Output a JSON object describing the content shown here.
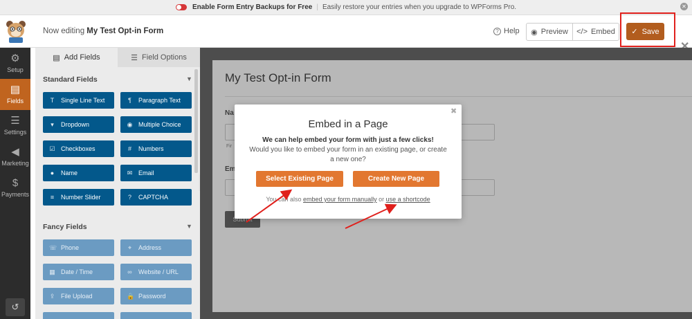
{
  "notice": {
    "title": "Enable Form Entry Backups for Free",
    "text": "Easily restore your entries when you upgrade to WPForms Pro."
  },
  "header": {
    "editing_prefix": "Now editing",
    "form_name": "My Test Opt-in Form",
    "help_label": "Help",
    "preview_label": "Preview",
    "embed_label": "Embed",
    "save_label": "Save"
  },
  "sidebar": {
    "items": [
      {
        "label": "Setup",
        "icon": "gear-icon"
      },
      {
        "label": "Fields",
        "icon": "list-icon"
      },
      {
        "label": "Settings",
        "icon": "sliders-icon"
      },
      {
        "label": "Marketing",
        "icon": "megaphone-icon"
      },
      {
        "label": "Payments",
        "icon": "dollar-icon"
      }
    ]
  },
  "panel": {
    "tabs": [
      {
        "label": "Add Fields"
      },
      {
        "label": "Field Options"
      }
    ],
    "standard_title": "Standard Fields",
    "standard_fields": [
      {
        "label": "Single Line Text",
        "icon": "T"
      },
      {
        "label": "Paragraph Text",
        "icon": "¶"
      },
      {
        "label": "Dropdown",
        "icon": "▾"
      },
      {
        "label": "Multiple Choice",
        "icon": "◉"
      },
      {
        "label": "Checkboxes",
        "icon": "☑"
      },
      {
        "label": "Numbers",
        "icon": "#"
      },
      {
        "label": "Name",
        "icon": "●"
      },
      {
        "label": "Email",
        "icon": "✉"
      },
      {
        "label": "Number Slider",
        "icon": "≡"
      },
      {
        "label": "CAPTCHA",
        "icon": "?"
      }
    ],
    "fancy_title": "Fancy Fields",
    "fancy_fields": [
      {
        "label": "Phone",
        "icon": "☏"
      },
      {
        "label": "Address",
        "icon": "⌖"
      },
      {
        "label": "Date / Time",
        "icon": "▦"
      },
      {
        "label": "Website / URL",
        "icon": "∞"
      },
      {
        "label": "File Upload",
        "icon": "⇪"
      },
      {
        "label": "Password",
        "icon": "🔒"
      }
    ]
  },
  "form": {
    "title": "My Test Opt-in Form",
    "name_label": "Na",
    "name_sub": "Fir",
    "email_label": "Em",
    "submit_label": "Submit"
  },
  "modal": {
    "title": "Embed in a Page",
    "desc_bold": "We can help embed your form with just a few clicks!",
    "desc_rest": "Would you like to embed your form in an existing page, or create a new one?",
    "select_existing": "Select Existing Page",
    "create_new": "Create New Page",
    "foot_prefix": "You can also",
    "foot_link1": "embed your form manually",
    "foot_or": "or",
    "foot_link2": "use a shortcode"
  },
  "colors": {
    "accent_orange": "#e27730",
    "save_brown": "#b25d1e",
    "field_blue": "#03588b",
    "annotation_red": "#e0201c"
  }
}
